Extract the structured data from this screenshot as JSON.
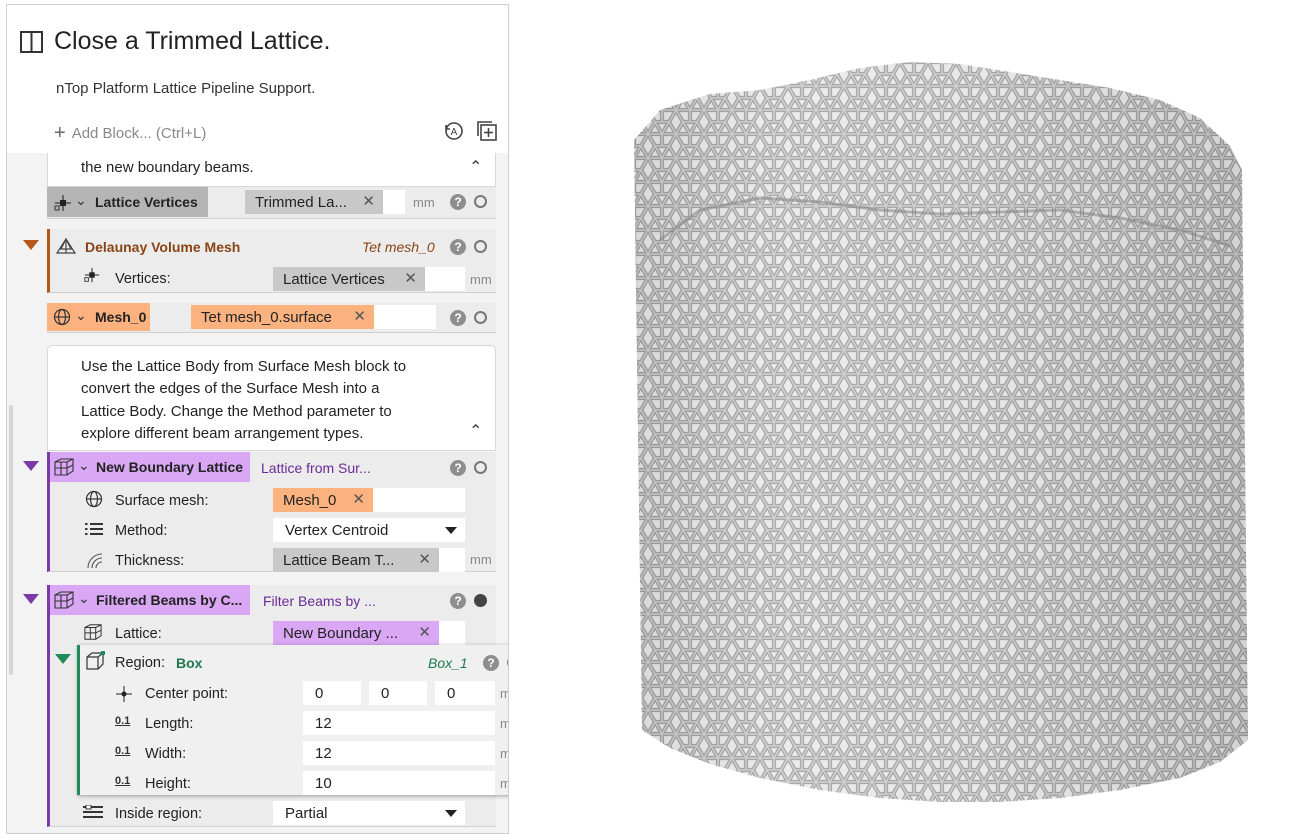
{
  "notebook": {
    "title": "Close a Trimmed Lattice.",
    "description": "nTop Platform Lattice Pipeline Support.",
    "add_block": "Add Block... (Ctrl+L)"
  },
  "note1": {
    "text": "the new boundary beams."
  },
  "lattice_vertices": {
    "name": "Lattice Vertices",
    "input": "Trimmed La...",
    "unit": "mm"
  },
  "delaunay": {
    "name": "Delaunay Volume Mesh",
    "var": "Tet mesh_0",
    "param_label": "Vertices:",
    "param_value": "Lattice Vertices",
    "unit": "mm"
  },
  "mesh0": {
    "name": "Mesh_0",
    "value": "Tet mesh_0.surface"
  },
  "note2": {
    "lines": [
      "Use the Lattice Body from Surface Mesh block to",
      "convert the edges of the Surface Mesh into a",
      "Lattice Body. Change the Method parameter to",
      "explore different beam arrangement types."
    ]
  },
  "boundary_lattice": {
    "name": "New Boundary Lattice",
    "var": "Lattice from Sur...",
    "params": [
      {
        "label": "Surface mesh:",
        "value": "Mesh_0"
      },
      {
        "label": "Method:",
        "value": "Vertex Centroid"
      },
      {
        "label": "Thickness:",
        "value": "Lattice Beam T...",
        "unit": "mm"
      }
    ]
  },
  "filtered_beams": {
    "name": "Filtered Beams by C...",
    "var": "Filter Beams by ...",
    "lattice_label": "Lattice:",
    "lattice_value": "New Boundary ...",
    "region_label": "Region:",
    "region_type": "Box",
    "region_var": "Box_1",
    "center_label": "Center point:",
    "center": [
      "0",
      "0",
      "0"
    ],
    "length_label": "Length:",
    "length": "12",
    "width_label": "Width:",
    "width": "12",
    "height_label": "Height:",
    "height": "10",
    "unit": "mm",
    "inside_label": "Inside region:",
    "inside_value": "Partial"
  },
  "colors": {
    "orange_accent": "#b5561a",
    "orange_chip": "#fbb27f",
    "purple_accent": "#7a3aa8",
    "purple_chip": "#d9a7f3",
    "green_accent": "#1f8a5a",
    "gray_chip": "#c8c8c8"
  }
}
